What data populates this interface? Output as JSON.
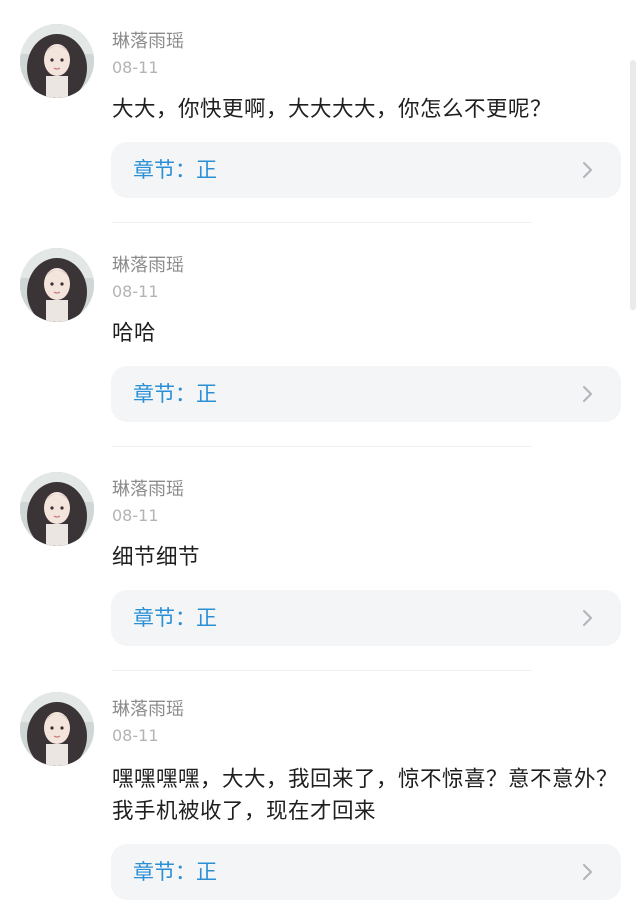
{
  "comments": [
    {
      "username": "琳落雨瑶",
      "date": "08-11",
      "text": "大大，你快更啊，大大大大，你怎么不更呢？",
      "chapter_label": "章节：正"
    },
    {
      "username": "琳落雨瑶",
      "date": "08-11",
      "text": "哈哈",
      "chapter_label": "章节：正"
    },
    {
      "username": "琳落雨瑶",
      "date": "08-11",
      "text": "细节细节",
      "chapter_label": "章节：正"
    },
    {
      "username": "琳落雨瑶",
      "date": "08-11",
      "text": "嘿嘿嘿嘿，大大，我回来了，惊不惊喜？意不意外？我手机被收了，现在才回来",
      "chapter_label": "章节：正"
    }
  ],
  "icons": {
    "chevron": "chevron-right-icon",
    "avatar": "avatar"
  },
  "colors": {
    "chapter_text": "#2b8fd6",
    "card_bg": "#f4f5f7",
    "username": "#8c8c8c",
    "date": "#b3b3b3",
    "body_text": "#1f1f1f"
  }
}
